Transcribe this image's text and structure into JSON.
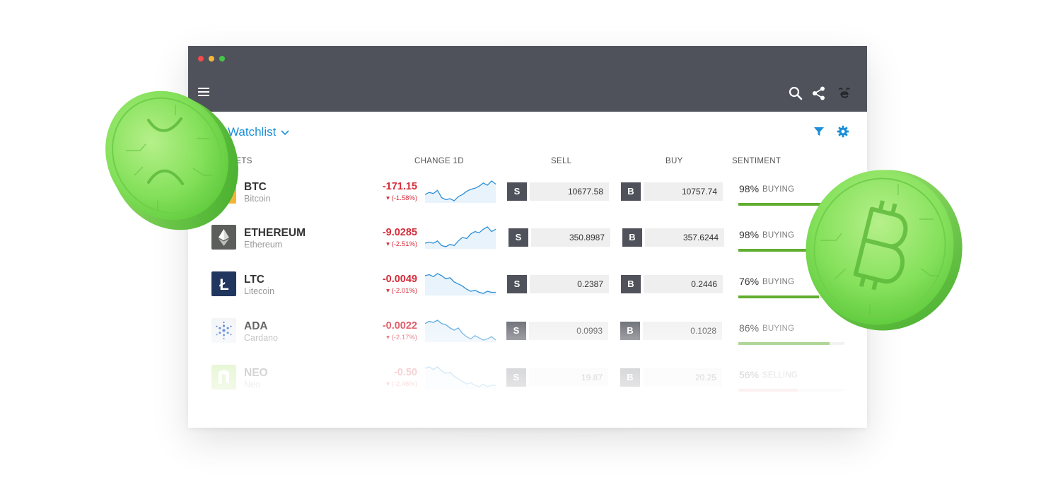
{
  "window": {
    "watchlist_title": "Watchlist",
    "columns": {
      "markets": "MARKETS",
      "change": "CHANGE 1D",
      "sell": "SELL",
      "buy": "BUY",
      "sentiment": "SENTIMENT"
    },
    "sell_label": "S",
    "buy_label": "B"
  },
  "icons": {
    "menu": "hamburger-icon",
    "search": "search-icon",
    "share": "share-icon",
    "brand": "etoro-logo-icon",
    "watchlist_toggle": "chevron-down-icon",
    "filter": "filter-icon",
    "settings": "gear-icon"
  },
  "colors": {
    "titlebar": "#50525b",
    "accent": "#1a8fd6",
    "negative": "#d42c3a",
    "buying": "#5fae2f",
    "selling": "#f09aa1",
    "sparkline": "#2d8fd5"
  },
  "rows": [
    {
      "symbol": "BTC",
      "name": "Bitcoin",
      "icon": "bitcoin-icon",
      "change": "-171.15",
      "change_pct": "(-1.58%)",
      "sell": "10677.58",
      "buy": "10757.74",
      "sentiment_pct": "98%",
      "sentiment_label": "BUYING",
      "sentiment_value": 98,
      "spark": [
        20,
        22,
        21,
        24,
        17,
        15,
        16,
        14,
        18,
        20,
        23,
        25,
        26,
        28,
        31,
        29,
        33,
        30
      ]
    },
    {
      "symbol": "ETHEREUM",
      "name": "Ethereum",
      "icon": "ethereum-icon",
      "change": "-9.0285",
      "change_pct": "(-2.51%)",
      "sell": "350.8987",
      "buy": "357.6244",
      "sentiment_pct": "98%",
      "sentiment_label": "BUYING",
      "sentiment_value": 98,
      "spark": [
        18,
        19,
        18,
        20,
        16,
        15,
        17,
        16,
        20,
        23,
        22,
        26,
        28,
        27,
        30,
        32,
        28,
        30
      ]
    },
    {
      "symbol": "LTC",
      "name": "Litecoin",
      "icon": "litecoin-icon",
      "change": "-0.0049",
      "change_pct": "(-2.01%)",
      "sell": "0.2387",
      "buy": "0.2446",
      "sentiment_pct": "76%",
      "sentiment_label": "BUYING",
      "sentiment_value": 76,
      "spark": [
        30,
        31,
        29,
        32,
        30,
        27,
        28,
        24,
        22,
        20,
        17,
        15,
        16,
        14,
        13,
        15,
        14,
        14
      ]
    },
    {
      "symbol": "ADA",
      "name": "Cardano",
      "icon": "cardano-icon",
      "change": "-0.0022",
      "change_pct": "(-2.17%)",
      "sell": "0.0993",
      "buy": "0.1028",
      "sentiment_pct": "86%",
      "sentiment_label": "BUYING",
      "sentiment_value": 86,
      "spark": [
        28,
        30,
        29,
        31,
        28,
        27,
        24,
        22,
        24,
        19,
        16,
        14,
        17,
        15,
        13,
        14,
        16,
        13
      ]
    },
    {
      "symbol": "NEO",
      "name": "Neo",
      "icon": "neo-icon",
      "change": "-0.50",
      "change_pct": "(-2.46%)",
      "sell": "19.87",
      "buy": "20.25",
      "sentiment_pct": "56%",
      "sentiment_label": "SELLING",
      "sentiment_value": 56,
      "spark": [
        28,
        29,
        27,
        29,
        26,
        24,
        25,
        22,
        20,
        18,
        16,
        17,
        15,
        14,
        16,
        14,
        15,
        15
      ]
    }
  ]
}
